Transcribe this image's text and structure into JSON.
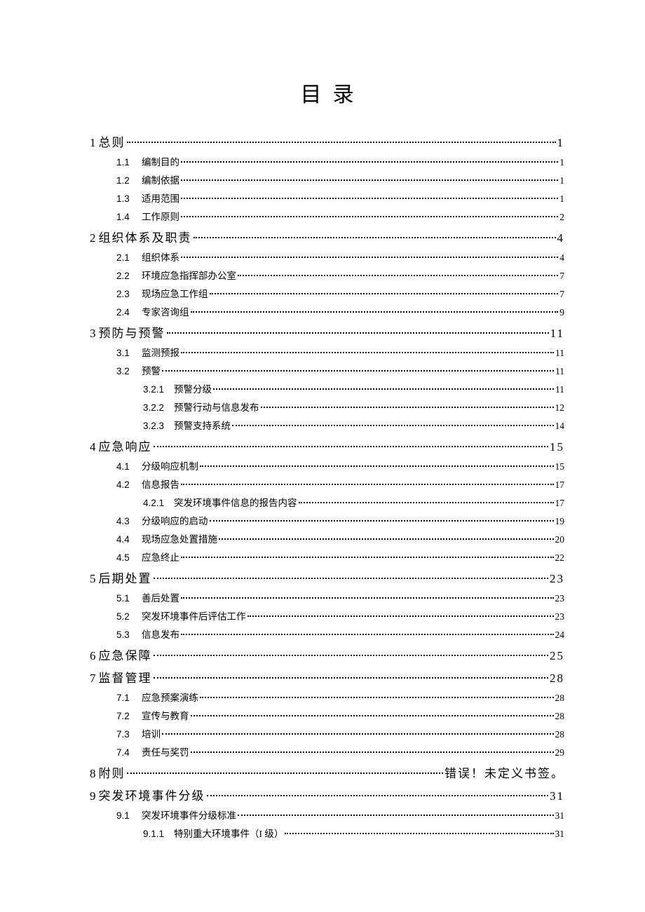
{
  "title": "目录",
  "entries": [
    {
      "level": 1,
      "num": "1",
      "label": "总则",
      "page": "1"
    },
    {
      "level": 2,
      "num": "1.1",
      "label": "编制目的",
      "page": "1"
    },
    {
      "level": 2,
      "num": "1.2",
      "label": "编制依据",
      "page": "1"
    },
    {
      "level": 2,
      "num": "1.3",
      "label": "适用范围",
      "page": "1"
    },
    {
      "level": 2,
      "num": "1.4",
      "label": "工作原则",
      "page": "2"
    },
    {
      "level": 1,
      "num": "2",
      "label": "组织体系及职责",
      "page": "4"
    },
    {
      "level": 2,
      "num": "2.1",
      "label": "组织体系",
      "page": "4"
    },
    {
      "level": 2,
      "num": "2.2",
      "label": "环境应急指挥部办公室",
      "page": "7"
    },
    {
      "level": 2,
      "num": "2.3",
      "label": "现场应急工作组",
      "page": "7"
    },
    {
      "level": 2,
      "num": "2.4",
      "label": "专家咨询组",
      "page": "9"
    },
    {
      "level": 1,
      "num": "3",
      "label": "预防与预警",
      "page": "11"
    },
    {
      "level": 2,
      "num": "3.1",
      "label": "监测预报",
      "page": "11"
    },
    {
      "level": 2,
      "num": "3.2",
      "label": "预警",
      "page": "11"
    },
    {
      "level": 3,
      "num": "3.2.1",
      "label": "预警分级",
      "page": "11"
    },
    {
      "level": 3,
      "num": "3.2.2",
      "label": "预警行动与信息发布",
      "page": "12"
    },
    {
      "level": 3,
      "num": "3.2.3",
      "label": "预警支持系统",
      "page": "14"
    },
    {
      "level": 1,
      "num": "4",
      "label": "应急响应",
      "page": "15"
    },
    {
      "level": 2,
      "num": "4.1",
      "label": "分级响应机制",
      "page": "15"
    },
    {
      "level": 2,
      "num": "4.2",
      "label": "信息报告",
      "page": "17"
    },
    {
      "level": 3,
      "num": "4.2.1",
      "label": "突发环境事件信息的报告内容",
      "page": "17"
    },
    {
      "level": 2,
      "num": "4.3",
      "label": "分级响应的启动",
      "page": "19"
    },
    {
      "level": 2,
      "num": "4.4",
      "label": "现场应急处置措施",
      "page": "20"
    },
    {
      "level": 2,
      "num": "4.5",
      "label": "应急终止",
      "page": "22"
    },
    {
      "level": 1,
      "num": "5",
      "label": "后期处置",
      "page": "23"
    },
    {
      "level": 2,
      "num": "5.1",
      "label": "善后处置",
      "page": "23"
    },
    {
      "level": 2,
      "num": "5.2",
      "label": "突发环境事件后评估工作",
      "page": "23"
    },
    {
      "level": 2,
      "num": "5.3",
      "label": "信息发布",
      "page": "24"
    },
    {
      "level": 1,
      "num": "6",
      "label": "应急保障",
      "page": "25"
    },
    {
      "level": 1,
      "num": "7",
      "label": "监督管理",
      "page": "28"
    },
    {
      "level": 2,
      "num": "7.1",
      "label": "应急预案演练",
      "page": "28"
    },
    {
      "level": 2,
      "num": "7.2",
      "label": "宣传与教育",
      "page": "28"
    },
    {
      "level": 2,
      "num": "7.3",
      "label": "培训",
      "page": "28"
    },
    {
      "level": 2,
      "num": "7.4",
      "label": "责任与奖罚",
      "page": "29"
    },
    {
      "level": 1,
      "num": "8",
      "label": "附则",
      "page": "错误！未定义书签。",
      "page_cn": true
    },
    {
      "level": 1,
      "num": "9",
      "label": "突发环境事件分级",
      "page": "31"
    },
    {
      "level": 2,
      "num": "9.1",
      "label": "突发环境事件分级标准",
      "page": "31"
    },
    {
      "level": 3,
      "num": "9.1.1",
      "label": "特别重大环境事件（I 级）",
      "page": "31"
    }
  ]
}
